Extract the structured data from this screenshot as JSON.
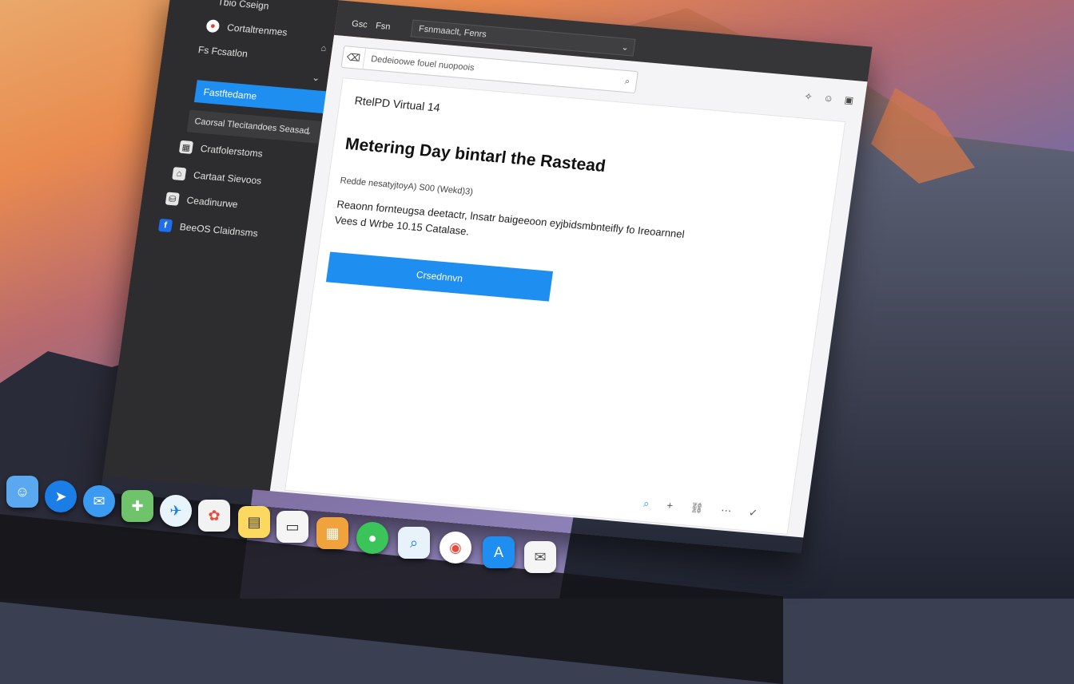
{
  "colors": {
    "accent": "#1e8ff0",
    "sidebar_bg": "#2d2d2f",
    "main_bg": "#f4f4f6"
  },
  "sidebar": {
    "items": [
      {
        "label": "Tbio Cseign",
        "icon": "app-icon"
      },
      {
        "label": "Cortaltrenmes",
        "icon": "record-icon",
        "trailing": "lock-icon"
      },
      {
        "label": "Fs Fcsatlon",
        "icon": "folder-icon",
        "trailing": "chevron-down-icon"
      },
      {
        "label": "Fastftedame",
        "icon": "selected-item",
        "selected": true
      },
      {
        "label": "Caorsal Tlecitandoes Seasad",
        "icon": "dropdown",
        "trailing": "chevron-down-icon"
      },
      {
        "label": "Cratfolerstoms",
        "icon": "grid-icon"
      },
      {
        "label": "Cartaat Sievoos",
        "icon": "home-icon"
      },
      {
        "label": "Ceadinurwe",
        "icon": "disk-icon"
      },
      {
        "label": "BeeOS Claidnsms",
        "icon": "facebook-icon"
      }
    ]
  },
  "topbar": {
    "tabs": [
      "Gsc",
      "Fsn"
    ],
    "select_value": "Fsnmaaclt, Fenrs"
  },
  "search": {
    "placeholder": "Dedeioowe fouel nuopoois"
  },
  "toolbar": {
    "icons": [
      "star-icon",
      "user-icon",
      "settings-icon"
    ]
  },
  "content": {
    "breadcrumb": "RtelPD Virtual 14",
    "headline": "Metering Day bintarl the Rastead",
    "subline": "Redde nesatyjtoyA) S00 (Wekd)3)",
    "body_line1": "Reaonn fornteugsa deetactr, lnsatr baigeeoon eyjbidsmbnteifly fo Ireoarnnel",
    "body_line2": "Vees d Wrbe 10.15 Catalase.",
    "cta_label": "Crsednnvn"
  },
  "bottom_tools": [
    "search-icon",
    "add-icon",
    "link-icon",
    "more-icon",
    "check-icon"
  ],
  "dock": {
    "apps": [
      "finder",
      "safari",
      "messages",
      "maps",
      "safari-compass",
      "photos",
      "notes",
      "text",
      "contacts",
      "facetime",
      "preview",
      "chrome",
      "app-store",
      "mail"
    ]
  }
}
